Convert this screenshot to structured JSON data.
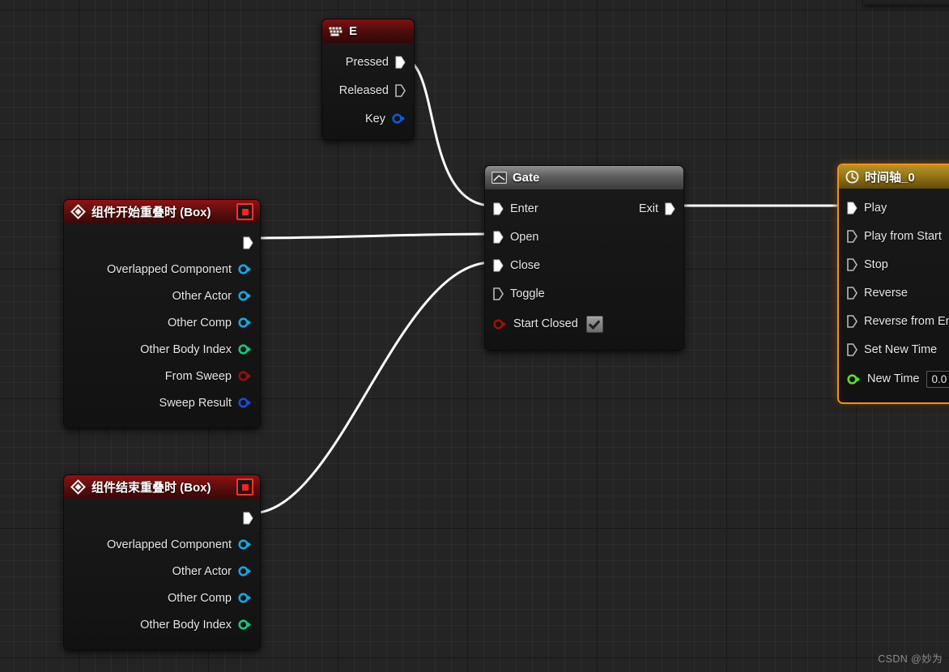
{
  "app": {
    "name": "Unreal Engine Blueprint Event Graph",
    "watermark": "CSDN @妙为"
  },
  "nodes": {
    "key_event_e": {
      "title": "E",
      "icon": "keyboard-icon",
      "header_color": "#7c1212",
      "outputs": [
        {
          "label": "Pressed",
          "type": "exec",
          "connected": true
        },
        {
          "label": "Released",
          "type": "exec",
          "connected": false
        },
        {
          "label": "Key",
          "type": "data",
          "color": "#1457d6",
          "connected": false
        }
      ]
    },
    "begin_overlap": {
      "title": "组件开始重叠时 (Box)",
      "icon": "event-diamond-icon",
      "badge": "stop-square-icon",
      "header_color": "#8d1313",
      "outputs": [
        {
          "label": "",
          "type": "exec",
          "connected": true
        },
        {
          "label": "Overlapped Component",
          "type": "data",
          "color": "#1ba6de",
          "connected": false
        },
        {
          "label": "Other Actor",
          "type": "data",
          "color": "#1ba6de",
          "connected": false
        },
        {
          "label": "Other Comp",
          "type": "data",
          "color": "#1ba6de",
          "connected": false
        },
        {
          "label": "Other Body Index",
          "type": "data",
          "color": "#18c77d",
          "connected": false
        },
        {
          "label": "From Sweep",
          "type": "data",
          "color": "#9b0f0f",
          "connected": false
        },
        {
          "label": "Sweep Result",
          "type": "data",
          "color": "#1a4ad8",
          "connected": false
        }
      ]
    },
    "end_overlap": {
      "title": "组件结束重叠时 (Box)",
      "icon": "event-diamond-icon",
      "badge": "stop-square-icon",
      "header_color": "#8d1313",
      "outputs": [
        {
          "label": "",
          "type": "exec",
          "connected": true
        },
        {
          "label": "Overlapped Component",
          "type": "data",
          "color": "#1ba6de",
          "connected": false
        },
        {
          "label": "Other Actor",
          "type": "data",
          "color": "#1ba6de",
          "connected": false
        },
        {
          "label": "Other Comp",
          "type": "data",
          "color": "#1ba6de",
          "connected": false
        },
        {
          "label": "Other Body Index",
          "type": "data",
          "color": "#18c77d",
          "connected": false
        }
      ]
    },
    "gate": {
      "title": "Gate",
      "icon": "gate-icon",
      "header_color": "#6e6e6e",
      "inputs": [
        {
          "label": "Enter",
          "type": "exec",
          "connected": true
        },
        {
          "label": "Open",
          "type": "exec",
          "connected": true
        },
        {
          "label": "Close",
          "type": "exec",
          "connected": true
        },
        {
          "label": "Toggle",
          "type": "exec",
          "connected": false
        },
        {
          "label": "Start Closed",
          "type": "data",
          "color": "#9b0f0f",
          "connected": false,
          "checkbox": true,
          "checked": true
        }
      ],
      "outputs": [
        {
          "label": "Exit",
          "type": "exec",
          "connected": true
        }
      ]
    },
    "timeline": {
      "title": "时间轴_0",
      "icon": "clock-icon",
      "header_color": "#b79326",
      "selected": true,
      "inputs": [
        {
          "label": "Play",
          "type": "exec",
          "connected": true
        },
        {
          "label": "Play from Start",
          "type": "exec",
          "connected": false
        },
        {
          "label": "Stop",
          "type": "exec",
          "connected": false
        },
        {
          "label": "Reverse",
          "type": "exec",
          "connected": false
        },
        {
          "label": "Reverse from End",
          "type": "exec",
          "connected": false
        },
        {
          "label": "Set New Time",
          "type": "exec",
          "connected": false
        },
        {
          "label": "New Time",
          "type": "data",
          "color": "#5ddc32",
          "connected": false,
          "value": "0.0"
        }
      ]
    }
  },
  "connections": [
    {
      "from": "key_event_e.Pressed",
      "to": "gate.Enter",
      "color": "#ffffff"
    },
    {
      "from": "begin_overlap.exec",
      "to": "gate.Open",
      "color": "#ffffff"
    },
    {
      "from": "end_overlap.exec",
      "to": "gate.Close",
      "color": "#ffffff"
    },
    {
      "from": "gate.Exit",
      "to": "timeline.Play",
      "color": "#ffffff"
    }
  ]
}
